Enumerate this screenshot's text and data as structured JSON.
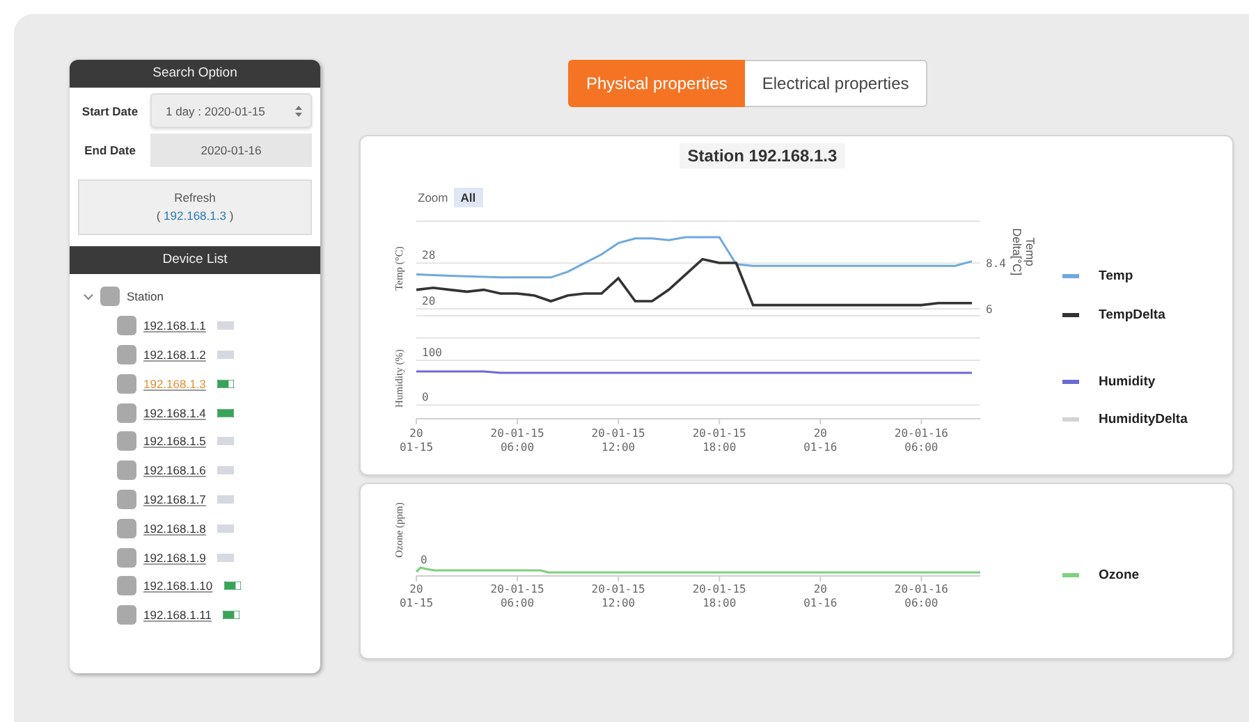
{
  "sidebar": {
    "search_option": {
      "title": "Search Option",
      "start_date": {
        "label": "Start Date",
        "value": "1 day : 2020-01-15"
      },
      "end_date": {
        "label": "End Date",
        "value": "2020-01-16"
      },
      "refresh": {
        "label": "Refresh",
        "prefix": "( ",
        "link": "192.168.1.3",
        "suffix": " )"
      }
    },
    "device_list": {
      "title": "Device List",
      "tree": [
        {
          "label": "Station",
          "expanded": true,
          "checked": false,
          "children": [
            {
              "label": "192.168.1.1",
              "selected": false,
              "checked": false,
              "online": false
            },
            {
              "label": "192.168.1.2",
              "selected": false,
              "checked": false,
              "online": false
            },
            {
              "label": "192.168.1.3",
              "selected": true,
              "checked": false,
              "online": true,
              "full": false
            },
            {
              "label": "192.168.1.4",
              "selected": false,
              "checked": false,
              "online": true,
              "full": true
            },
            {
              "label": "192.168.1.5",
              "selected": false,
              "checked": false,
              "online": false
            },
            {
              "label": "192.168.1.6",
              "selected": false,
              "checked": false,
              "online": false
            },
            {
              "label": "192.168.1.7",
              "selected": false,
              "checked": false,
              "online": false
            },
            {
              "label": "192.168.1.8",
              "selected": false,
              "checked": false,
              "online": false
            },
            {
              "label": "192.168.1.9",
              "selected": false,
              "checked": false,
              "online": false
            },
            {
              "label": "192.168.1.10",
              "selected": false,
              "checked": false,
              "online": true,
              "full": false
            },
            {
              "label": "192.168.1.11",
              "selected": false,
              "checked": false,
              "online": true,
              "full": false
            }
          ]
        }
      ]
    }
  },
  "tabs": [
    {
      "label": "Physical properties",
      "selected": true
    },
    {
      "label": "Electrical properties",
      "selected": false
    }
  ],
  "station_card": {
    "title": "Station 192.168.1.3",
    "zoom": {
      "label": "Zoom",
      "buttons": [
        {
          "label": "All",
          "selected": true
        }
      ]
    },
    "temperature_chart": {
      "chart_data": {
        "type": "line",
        "ylabel": "Temp (°C)",
        "y2label": "Temp Delta[°C]",
        "legend": true,
        "ylim": [
          18.8,
          35.3
        ],
        "yticks": [
          20,
          28
        ],
        "y2lim": [
          5.64,
          10.58
        ],
        "y2ticks": [
          6,
          8.4
        ],
        "series": [
          {
            "name": "Temp",
            "color": "#6fa9dc",
            "values": [
              26.0,
              25.9,
              25.8,
              25.7,
              25.6,
              25.5,
              25.5,
              25.5,
              25.5,
              26.5,
              28.0,
              29.5,
              31.5,
              32.3,
              32.3,
              32.0,
              32.5,
              32.5,
              32.5,
              27.8,
              27.5,
              27.5,
              27.5,
              27.5,
              27.5,
              27.5,
              27.5,
              27.5,
              27.5,
              27.5,
              27.5,
              27.5,
              27.5,
              28.3
            ]
          },
          {
            "name": "TempDelta",
            "color": "#333333",
            "axis": "y2",
            "values": [
              7.0,
              7.1,
              7.0,
              6.9,
              7.0,
              6.8,
              6.8,
              6.7,
              6.4,
              6.7,
              6.8,
              6.8,
              7.6,
              6.4,
              6.4,
              7.0,
              7.8,
              8.6,
              8.4,
              8.4,
              6.2,
              6.2,
              6.2,
              6.2,
              6.2,
              6.2,
              6.2,
              6.2,
              6.2,
              6.2,
              6.2,
              6.3,
              6.3,
              6.3
            ]
          }
        ]
      }
    },
    "humidity_chart": {
      "chart_data": {
        "type": "line",
        "ylabel": "Humidity (%)",
        "legend": true,
        "ylim": [
          -31,
          150
        ],
        "yticks": [
          0,
          100
        ],
        "categories": [
          "20\n01-15",
          null,
          null,
          null,
          null,
          null,
          "20-01-15\n06:00",
          null,
          null,
          null,
          null,
          null,
          "20-01-15\n12:00",
          null,
          null,
          null,
          null,
          null,
          "20-01-15\n18:00",
          null,
          null,
          null,
          null,
          null,
          "20\n01-16",
          null,
          null,
          null,
          null,
          null,
          "20-01-16\n06:00",
          null,
          null,
          null
        ],
        "series": [
          {
            "name": "Humidity",
            "color": "#6a6ad2",
            "values": [
              75,
              75,
              75,
              75,
              75,
              72,
              72,
              72,
              72,
              72,
              72,
              72,
              72,
              72,
              72,
              72,
              72,
              72,
              72,
              72,
              72,
              72,
              72,
              72,
              72,
              72,
              72,
              72,
              72,
              72,
              72,
              72,
              72,
              72
            ]
          },
          {
            "name": "HumidityDelta",
            "color": "#d4d4d4",
            "values": [
              null,
              null,
              null,
              null,
              null,
              null,
              null,
              null,
              null,
              null,
              null,
              null,
              null,
              null,
              null,
              null,
              null,
              null,
              null,
              null,
              null,
              null,
              null,
              null,
              null,
              null,
              null,
              null,
              null,
              null,
              null,
              null,
              null,
              null
            ]
          }
        ]
      }
    }
  },
  "ozone_card": {
    "ylabel": "Ozone (ppm)",
    "ytick": "0",
    "xticks": [
      "20\n01-15",
      "20-01-15\n06:00",
      "20-01-15\n12:00",
      "20-01-15\n18:00",
      "20\n01-16",
      "20-01-16\n06:00"
    ],
    "legend": {
      "name": "Ozone",
      "color": "#7fd07f"
    }
  }
}
